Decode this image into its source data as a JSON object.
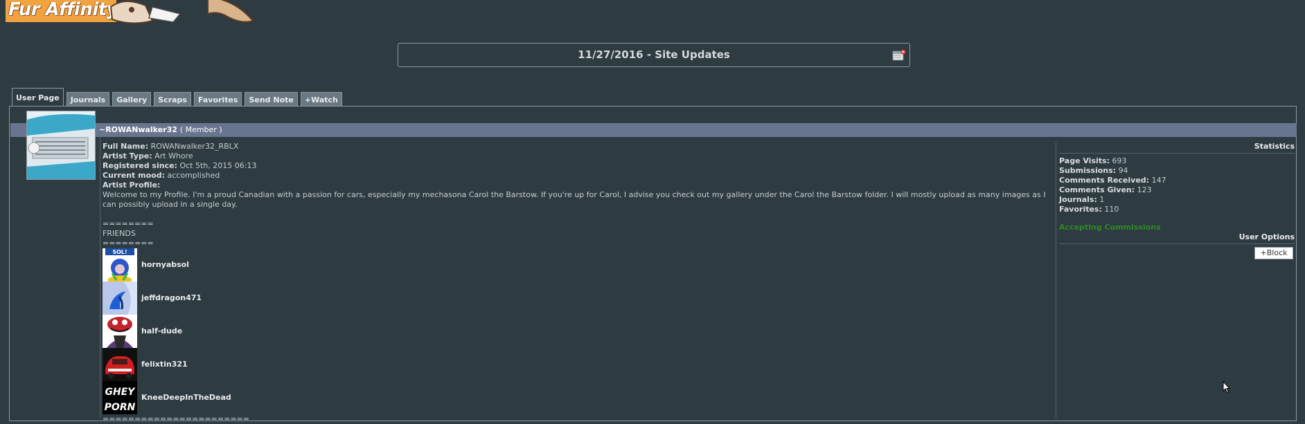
{
  "site": {
    "logo_text": "Fur Affinity"
  },
  "notice": {
    "title": "11/27/2016 - Site Updates",
    "icon": "calendar-close-icon"
  },
  "tabs": [
    {
      "label": "User Page",
      "active": true
    },
    {
      "label": "Journals"
    },
    {
      "label": "Gallery"
    },
    {
      "label": "Scraps"
    },
    {
      "label": "Favorites"
    },
    {
      "label": "Send Note"
    },
    {
      "label": "+Watch"
    }
  ],
  "user": {
    "username": "~ROWANwalker32",
    "role": "( Member )"
  },
  "profile": {
    "full_name_label": "Full Name:",
    "full_name": "ROWANwalker32_RBLX",
    "artist_type_label": "Artist Type:",
    "artist_type": "Art Whore",
    "registered_label": "Registered since:",
    "registered": "Oct 5th, 2015 06:13",
    "mood_label": "Current mood:",
    "mood": "accomplished",
    "artist_profile_label": "Artist Profile:",
    "bio": "Welcome to my Profile. I'm a proud Canadian with a passion for cars, especially my mechasona Carol the Barstow. If you're up for Carol, I advise you check out my gallery under the Carol the Barstow folder. I will mostly upload as many images as I can possibly upload in a single day.",
    "divider_short": "========",
    "friends_heading": "FRIENDS",
    "friends": [
      {
        "name": "hornyabsol"
      },
      {
        "name": "jeffdragon471"
      },
      {
        "name": "half-dude"
      },
      {
        "name": "felixtin321"
      },
      {
        "name": "KneeDeepInTheDead",
        "thumb_text_1": "GHEY",
        "thumb_text_2": "PORN"
      }
    ],
    "divider_long": "======================="
  },
  "stats": {
    "heading": "Statistics",
    "page_visits_label": "Page Visits:",
    "page_visits": "693",
    "submissions_label": "Submissions:",
    "submissions": "94",
    "comments_received_label": "Comments Received:",
    "comments_received": "147",
    "comments_given_label": "Comments Given:",
    "comments_given": "123",
    "journals_label": "Journals:",
    "journals": "1",
    "favorites_label": "Favorites:",
    "favorites": "110",
    "commission_status": "Accepting Commissions",
    "user_options_heading": "User Options",
    "block_label": "+Block"
  },
  "colors": {
    "accent_green": "#2f8a28",
    "name_bar": "#69758f",
    "background": "#2e3b41"
  }
}
